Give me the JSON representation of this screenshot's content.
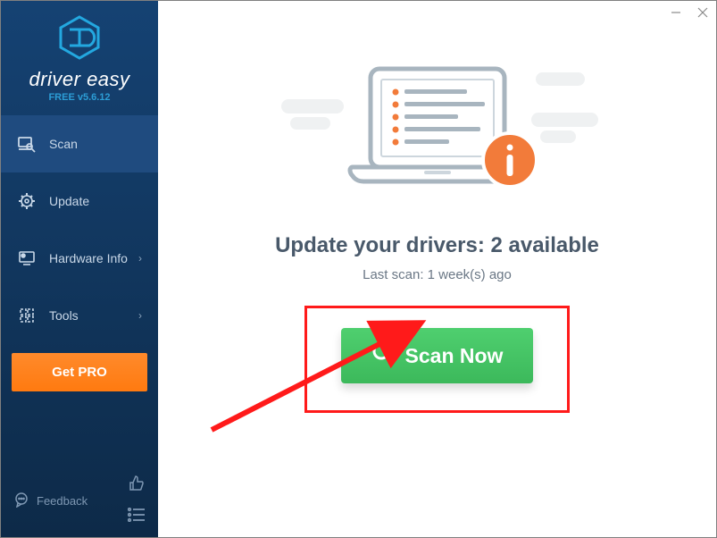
{
  "brand": {
    "name": "driver easy",
    "subtitle": "FREE v5.6.12"
  },
  "sidebar": {
    "items": [
      {
        "label": "Scan"
      },
      {
        "label": "Update"
      },
      {
        "label": "Hardware Info"
      },
      {
        "label": "Tools"
      }
    ],
    "get_pro": "Get PRO",
    "feedback": "Feedback"
  },
  "main": {
    "headline": "Update your drivers: 2 available",
    "last_scan": "Last scan: 1 week(s) ago",
    "scan_button": "Scan Now"
  }
}
